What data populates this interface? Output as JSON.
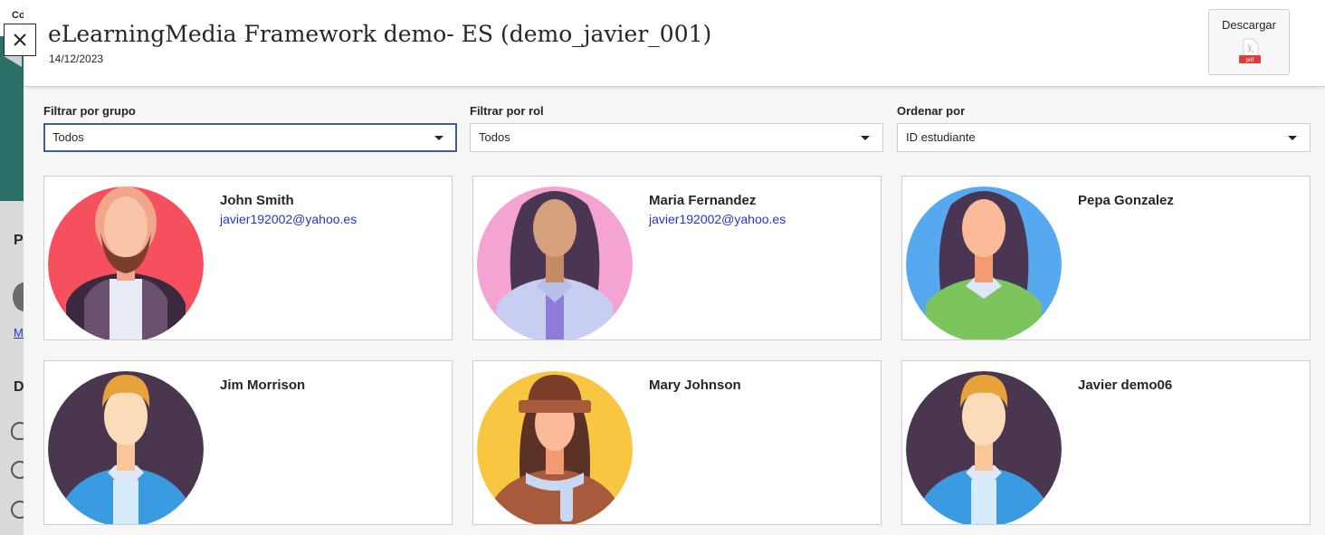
{
  "page": {
    "title": "eLearningMedia Framework demo- ES (demo_javier_001)",
    "date": "14/12/2023"
  },
  "actions": {
    "download_label": "Descargar",
    "pdf_icon_text": "pdf",
    "close_icon": "close-icon"
  },
  "filters": [
    {
      "label": "Filtrar por grupo",
      "value": "Todos"
    },
    {
      "label": "Filtrar por rol",
      "value": "Todos"
    },
    {
      "label": "Ordenar por",
      "value": "ID estudiante"
    }
  ],
  "students": [
    {
      "name": "John Smith",
      "email": "javier192002@yahoo.es",
      "avatar_bg": "#f64f5e"
    },
    {
      "name": "Maria Fernandez",
      "email": "javier192002@yahoo.es",
      "avatar_bg": "#f5a3d3"
    },
    {
      "name": "Pepa Gonzalez",
      "email": "",
      "avatar_bg": "#56a8ef"
    },
    {
      "name": "Jim Morrison",
      "email": "",
      "avatar_bg": "#4b3650"
    },
    {
      "name": "Mary Johnson",
      "email": "",
      "avatar_bg": "#f8c640"
    },
    {
      "name": "Javier demo06",
      "email": "",
      "avatar_bg": "#4b3650"
    }
  ],
  "background_page": {
    "fragments": [
      "Co",
      "P",
      "M",
      "D"
    ]
  },
  "colors": {
    "accent_focus": "#3d5f94",
    "link": "#2238c4",
    "pdf_red": "#e33b3b"
  }
}
